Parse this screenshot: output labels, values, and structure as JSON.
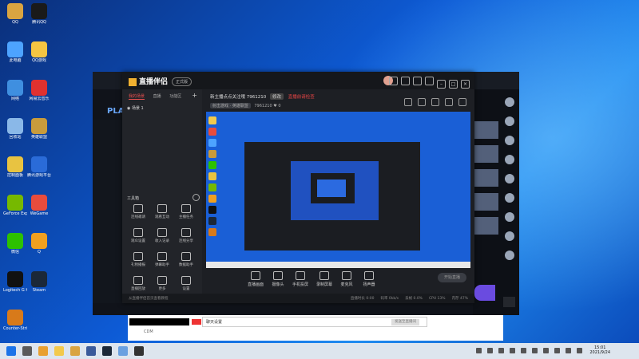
{
  "desktop": {
    "icons": [
      {
        "label": "QQ",
        "color": "#d9a441"
      },
      {
        "label": "腾讯QQ",
        "color": "#1a1a1a"
      },
      {
        "label": "此电脑",
        "color": "#4da3ff"
      },
      {
        "label": "QQ游戏",
        "color": "#f5c542"
      },
      {
        "label": "网络",
        "color": "#3f8fe0"
      },
      {
        "label": "网易云音乐",
        "color": "#e0312f"
      },
      {
        "label": "回收站",
        "color": "#8ab8e8"
      },
      {
        "label": "英雄联盟",
        "color": "#c89b3c"
      },
      {
        "label": "控制面板",
        "color": "#e8c341"
      },
      {
        "label": "腾讯游戏平台",
        "color": "#2a6bd8"
      },
      {
        "label": "GeForce Experience",
        "color": "#76b900"
      },
      {
        "label": "WeGame",
        "color": "#e84c3d"
      },
      {
        "label": "微信",
        "color": "#2dc100"
      },
      {
        "label": "Q",
        "color": "#f0a020"
      },
      {
        "label": "Logitech G HUB",
        "color": "#111111"
      },
      {
        "label": "Steam",
        "color": "#1b2838"
      },
      {
        "label": "Counter-Strike: Global Offensive",
        "color": "#d87a1a"
      }
    ]
  },
  "background_window": {
    "label": "PLA"
  },
  "app": {
    "logo_text": "直播伴侣",
    "version": "正式版",
    "tabs": [
      "我的场景",
      "直播",
      "功能区"
    ],
    "active_tab": "我的场景",
    "scene_item": "场景 1",
    "tools_header": "工具箱",
    "tools": [
      {
        "label": "连线邀请"
      },
      {
        "label": "观看互动"
      },
      {
        "label": "主播任务"
      },
      {
        "label": "观众设置"
      },
      {
        "label": "收入记录"
      },
      {
        "label": "连线分享"
      },
      {
        "label": "礼物播报"
      },
      {
        "label": "弹幕助手"
      },
      {
        "label": "数据助手"
      },
      {
        "label": "直播回放"
      },
      {
        "label": "更多"
      },
      {
        "label": "设置"
      }
    ],
    "stream_title": "新主播点点关注哦 7961210",
    "edit_label": "修改",
    "status_red": "直播前请检查",
    "tag_category": "射击游戏 · 英雄联盟",
    "room_id": "7961210",
    "viewer_count": "0",
    "bottom_tools": [
      {
        "label": "直播画面"
      },
      {
        "label": "摄像头"
      },
      {
        "label": "手机投屏"
      },
      {
        "label": "录制屏幕"
      },
      {
        "label": "麦克风"
      },
      {
        "label": "扬声器"
      }
    ],
    "start_live_label": "开始直播",
    "hint_text": "从直播伴侣首页查看教程",
    "status_items": [
      "直播时长 0:00",
      "码率 0kb/s",
      "丢帧 0.0%",
      "CPU 13%",
      "内存 47%"
    ]
  },
  "chat_window": {
    "input_text": "聊天设置",
    "send_label": "发送至直播间",
    "footer": "CDM"
  },
  "taskbar": {
    "time": "15:01",
    "date": "2021/9/24",
    "apps": [
      {
        "name": "start-button",
        "color": "#1a73e8"
      },
      {
        "name": "search",
        "color": "#5a5a5a"
      },
      {
        "name": "chrome",
        "color": "#e8a030"
      },
      {
        "name": "file-explorer",
        "color": "#f2c94c"
      },
      {
        "name": "qq",
        "color": "#d9a441"
      },
      {
        "name": "shield",
        "color": "#3a5a9a"
      },
      {
        "name": "steam",
        "color": "#1b2838"
      },
      {
        "name": "app",
        "color": "#6aa0e0"
      },
      {
        "name": "live-app",
        "color": "#333"
      }
    ]
  }
}
